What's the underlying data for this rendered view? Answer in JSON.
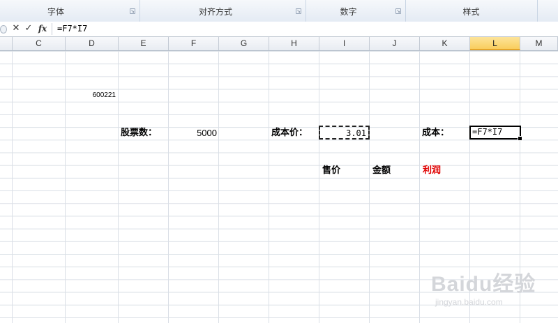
{
  "ribbon": {
    "groups": [
      {
        "label": "字体"
      },
      {
        "label": "对齐方式"
      },
      {
        "label": "数字"
      },
      {
        "label": "样式"
      }
    ]
  },
  "formula_bar": {
    "cancel_glyph": "✕",
    "enter_glyph": "✓",
    "function_label": "fx",
    "formula": "=F7*I7"
  },
  "columns": [
    "C",
    "D",
    "E",
    "F",
    "G",
    "H",
    "I",
    "J",
    "K",
    "L",
    "M"
  ],
  "selected_column": "L",
  "cells": {
    "d4": "600221",
    "e7_label": "股票数：",
    "f7_value": "5000",
    "h7_label": "成本价：",
    "i7_value": "3.01",
    "k7_label": "成本：",
    "l7_formula": "=F7*I7",
    "i10_label": "售价",
    "j10_label": "金额",
    "k10_label": "利润"
  },
  "watermark": {
    "main": "Baidu经验",
    "sub": "jingyan.baidu.com"
  },
  "colors": {
    "profit_label": "#e00000",
    "selected_header": "#f9ce5e"
  }
}
